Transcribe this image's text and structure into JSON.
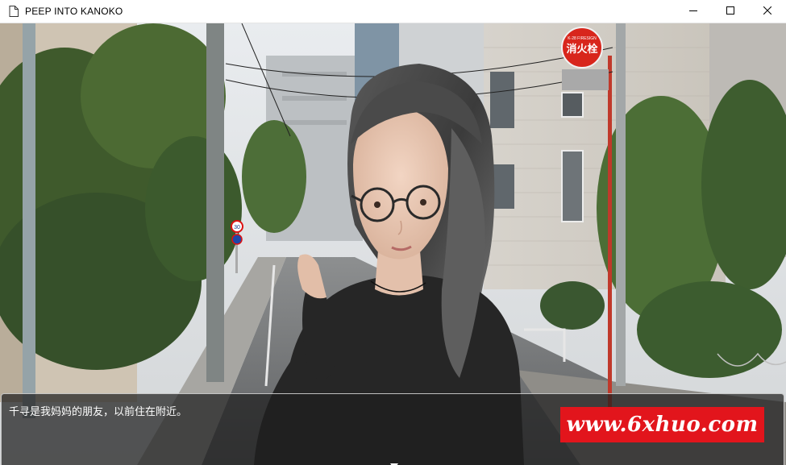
{
  "window": {
    "title": "PEEP INTO KANOKO",
    "app_icon": "document-icon",
    "minimize_icon": "minimize-icon",
    "maximize_icon": "maximize-icon",
    "close_icon": "close-icon"
  },
  "scene": {
    "sign_top": "K-28 FIRESIGN",
    "sign_main": "消火栓",
    "speed_limit": "30"
  },
  "dialogue": {
    "text": "千寻是我妈妈的朋友，以前住在附近。",
    "continue_icon": "triangle-down-icon"
  },
  "watermark": {
    "text": "www.6xhuo.com",
    "color": "#e2151c"
  }
}
